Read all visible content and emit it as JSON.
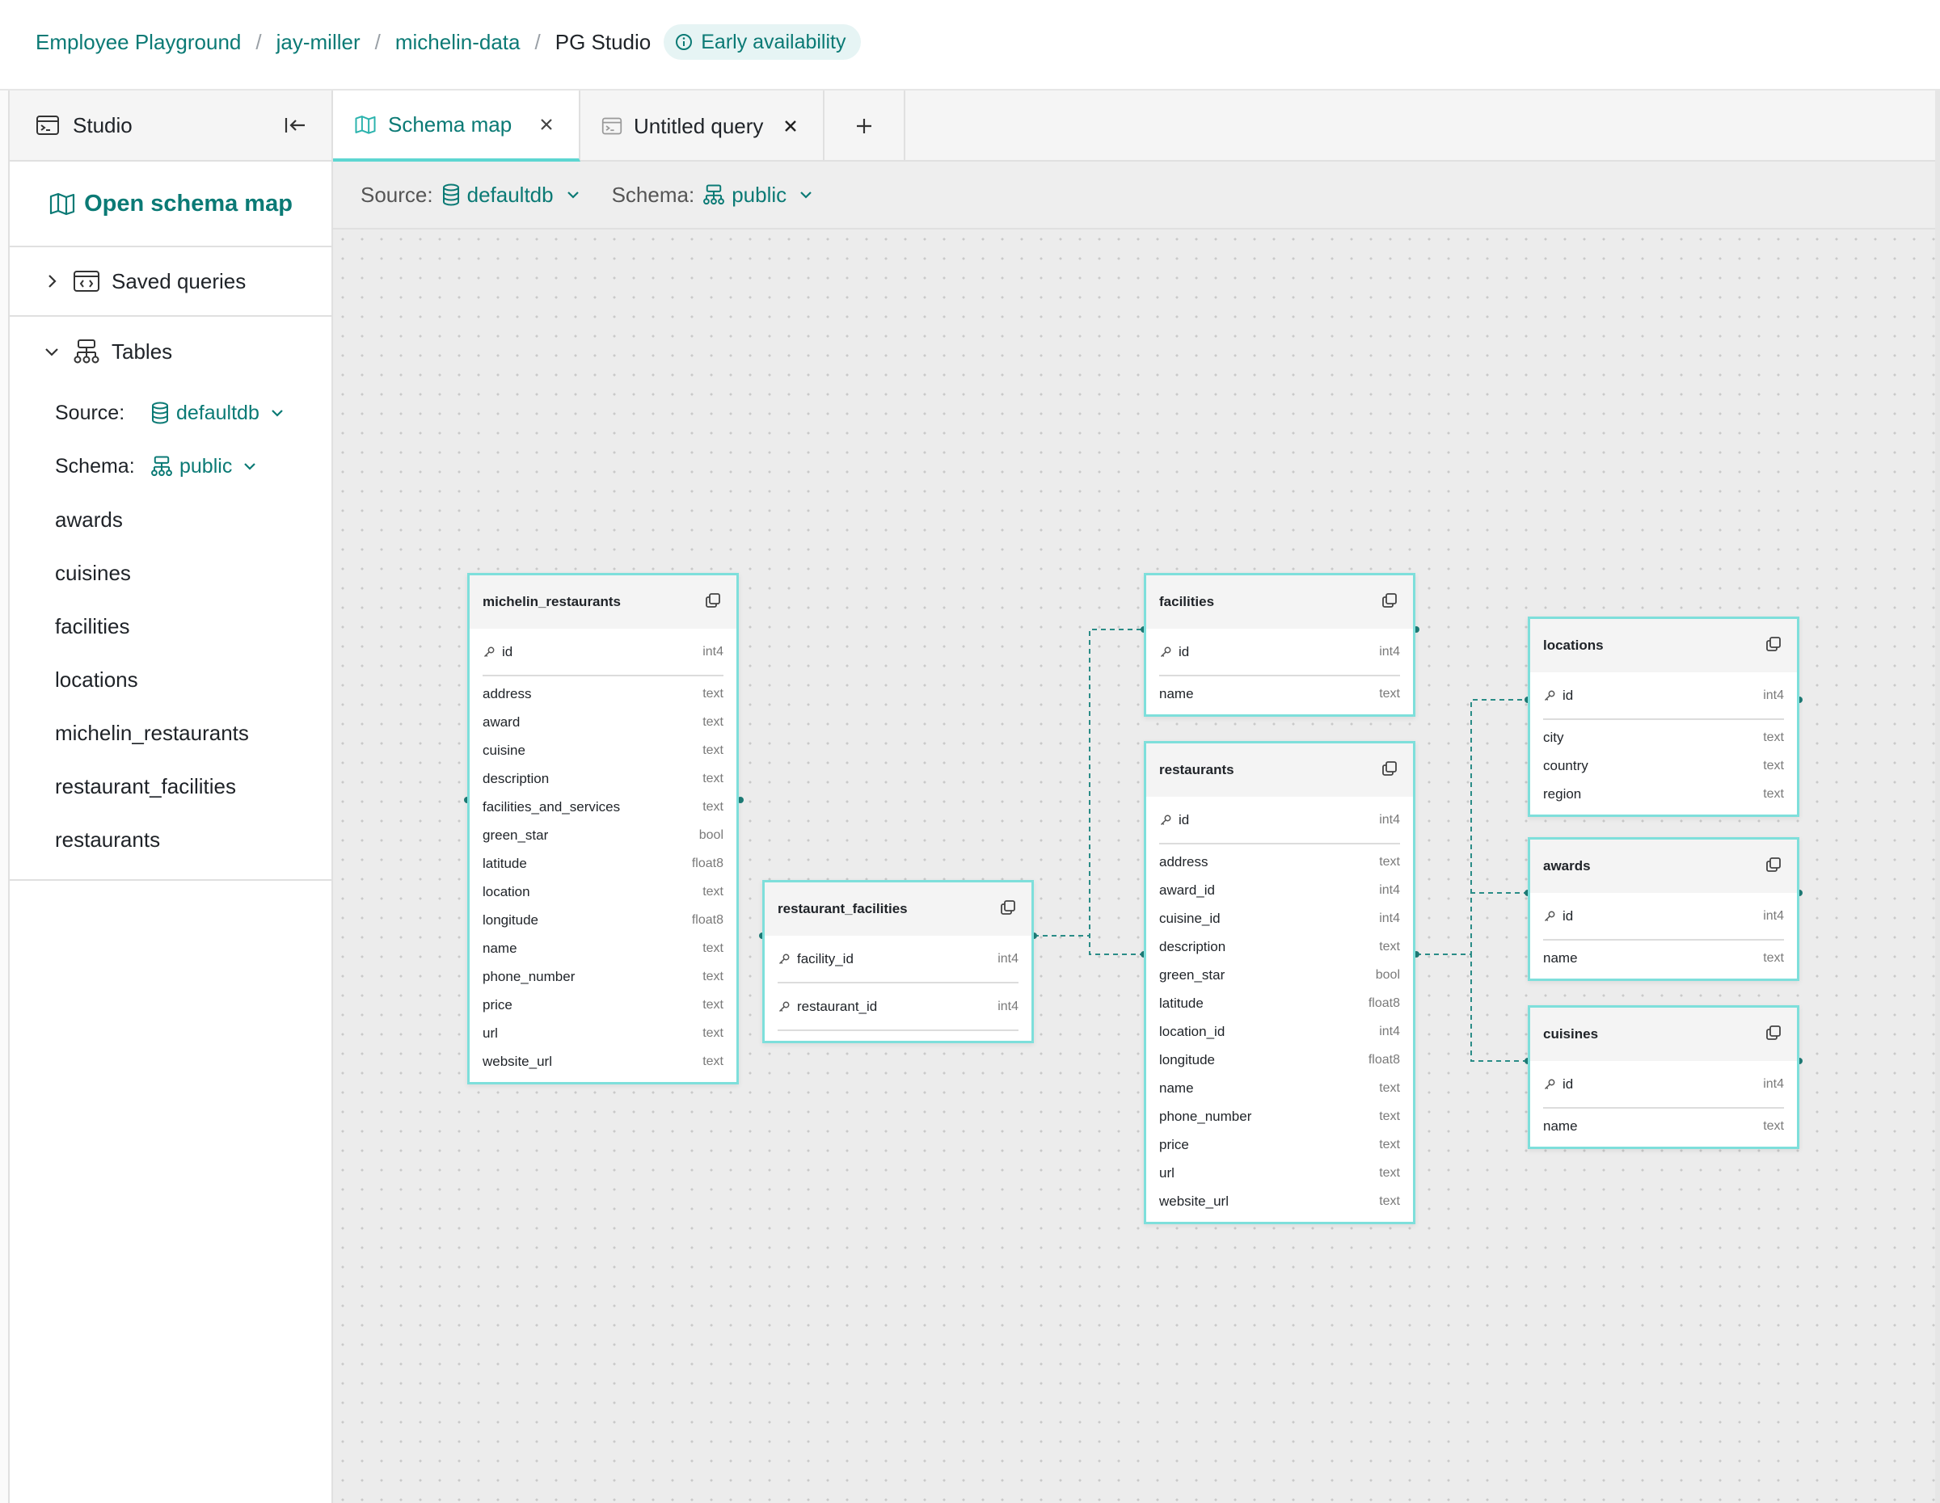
{
  "breadcrumb": {
    "items": [
      "Employee Playground",
      "jay-miller",
      "michelin-data"
    ],
    "current": "PG Studio",
    "separator": "/",
    "badge": "Early availability"
  },
  "sidebar": {
    "title": "Studio",
    "open_schema_label": "Open schema map",
    "saved_queries_label": "Saved queries",
    "tables_label": "Tables",
    "source_label": "Source:",
    "source_value": "defaultdb",
    "schema_label": "Schema:",
    "schema_value": "public",
    "tables": [
      "awards",
      "cuisines",
      "facilities",
      "locations",
      "michelin_restaurants",
      "restaurant_facilities",
      "restaurants"
    ]
  },
  "tabs": {
    "schema_map": "Schema map",
    "untitled_query": "Untitled query",
    "add": "+"
  },
  "toolbar": {
    "source_label": "Source:",
    "source_value": "defaultdb",
    "schema_label": "Schema:",
    "schema_value": "public"
  },
  "schema": {
    "michelin_restaurants": {
      "name": "michelin_restaurants",
      "pk": {
        "name": "id",
        "type": "int4"
      },
      "fields": [
        {
          "name": "address",
          "type": "text"
        },
        {
          "name": "award",
          "type": "text"
        },
        {
          "name": "cuisine",
          "type": "text"
        },
        {
          "name": "description",
          "type": "text"
        },
        {
          "name": "facilities_and_services",
          "type": "text"
        },
        {
          "name": "green_star",
          "type": "bool"
        },
        {
          "name": "latitude",
          "type": "float8"
        },
        {
          "name": "location",
          "type": "text"
        },
        {
          "name": "longitude",
          "type": "float8"
        },
        {
          "name": "name",
          "type": "text"
        },
        {
          "name": "phone_number",
          "type": "text"
        },
        {
          "name": "price",
          "type": "text"
        },
        {
          "name": "url",
          "type": "text"
        },
        {
          "name": "website_url",
          "type": "text"
        }
      ]
    },
    "restaurant_facilities": {
      "name": "restaurant_facilities",
      "keys": [
        {
          "name": "facility_id",
          "type": "int4"
        },
        {
          "name": "restaurant_id",
          "type": "int4"
        }
      ]
    },
    "facilities": {
      "name": "facilities",
      "pk": {
        "name": "id",
        "type": "int4"
      },
      "fields": [
        {
          "name": "name",
          "type": "text"
        }
      ]
    },
    "restaurants": {
      "name": "restaurants",
      "pk": {
        "name": "id",
        "type": "int4"
      },
      "fields": [
        {
          "name": "address",
          "type": "text"
        },
        {
          "name": "award_id",
          "type": "int4"
        },
        {
          "name": "cuisine_id",
          "type": "int4"
        },
        {
          "name": "description",
          "type": "text"
        },
        {
          "name": "green_star",
          "type": "bool"
        },
        {
          "name": "latitude",
          "type": "float8"
        },
        {
          "name": "location_id",
          "type": "int4"
        },
        {
          "name": "longitude",
          "type": "float8"
        },
        {
          "name": "name",
          "type": "text"
        },
        {
          "name": "phone_number",
          "type": "text"
        },
        {
          "name": "price",
          "type": "text"
        },
        {
          "name": "url",
          "type": "text"
        },
        {
          "name": "website_url",
          "type": "text"
        }
      ]
    },
    "locations": {
      "name": "locations",
      "pk": {
        "name": "id",
        "type": "int4"
      },
      "fields": [
        {
          "name": "city",
          "type": "text"
        },
        {
          "name": "country",
          "type": "text"
        },
        {
          "name": "region",
          "type": "text"
        }
      ]
    },
    "awards": {
      "name": "awards",
      "pk": {
        "name": "id",
        "type": "int4"
      },
      "fields": [
        {
          "name": "name",
          "type": "text"
        }
      ]
    },
    "cuisines": {
      "name": "cuisines",
      "pk": {
        "name": "id",
        "type": "int4"
      },
      "fields": [
        {
          "name": "name",
          "type": "text"
        }
      ]
    }
  },
  "icons": {
    "studio": "terminal-window-icon",
    "collapse": "collapse-sidebar-icon",
    "schema_map": "map-icon",
    "saved_queries": "code-file-icon",
    "tables": "sitemap-icon",
    "source": "database-icon",
    "schema": "sitemap-icon",
    "key": "key-icon",
    "copy": "copy-icon",
    "info": "info-icon"
  },
  "colors": {
    "accent": "#0b7a75",
    "card_border": "#7edfdb",
    "connector": "#2a8c87"
  }
}
